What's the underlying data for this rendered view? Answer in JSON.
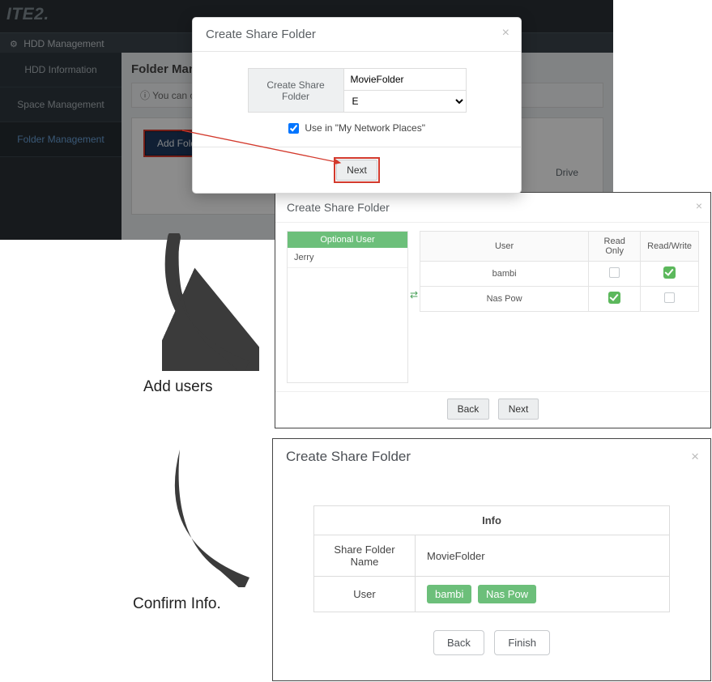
{
  "logo": "ITE2.",
  "breadcrumb": {
    "icon": "gear-icon",
    "text": "HDD Management"
  },
  "sidebar": {
    "items": [
      {
        "label": "HDD Information"
      },
      {
        "label": "Space Management"
      },
      {
        "label": "Folder Management"
      }
    ]
  },
  "main": {
    "heading": "Folder Management",
    "notice": "You can create share folders here.",
    "add_folder_label": "Add Folder",
    "drive_label": "Drive"
  },
  "modal1": {
    "title": "Create Share Folder",
    "field_label": "Create Share Folder",
    "folder_name": "MovieFolder",
    "drive": "E",
    "checkbox_label": "Use in \"My Network Places\"",
    "next_label": "Next"
  },
  "modal2": {
    "title": "Create Share Folder",
    "optional_user_header": "Optional User",
    "optional_users": [
      "Jerry"
    ],
    "table": {
      "headers": {
        "user": "User",
        "readonly": "Read Only",
        "readwrite": "Read/Write"
      },
      "rows": [
        {
          "user": "bambi",
          "readonly": false,
          "readwrite": true
        },
        {
          "user": "Nas Pow",
          "readonly": true,
          "readwrite": false
        }
      ]
    },
    "back_label": "Back",
    "next_label": "Next"
  },
  "modal3": {
    "title": "Create Share Folder",
    "info_heading": "Info",
    "rows": {
      "name_label": "Share Folder Name",
      "name_value": "MovieFolder",
      "user_label": "User",
      "users": [
        "bambi",
        "Nas Pow"
      ]
    },
    "back_label": "Back",
    "finish_label": "Finish"
  },
  "step_labels": {
    "add_users": "Add users",
    "confirm": "Confirm Info."
  }
}
